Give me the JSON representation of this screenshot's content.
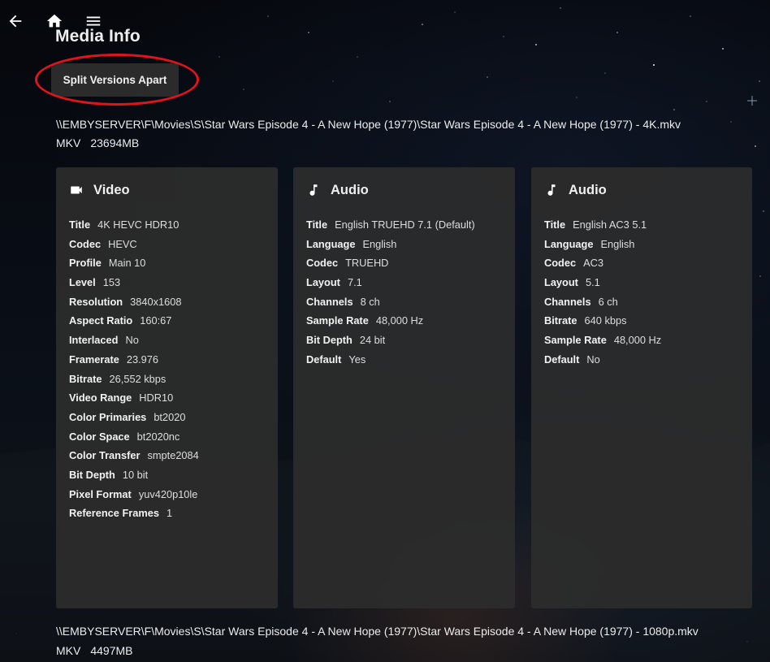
{
  "header": {
    "back_icon": "arrow-left-icon",
    "home_icon": "home-icon",
    "menu_icon": "hamburger-menu-icon"
  },
  "page": {
    "title": "Media Info",
    "split_button": "Split Versions Apart",
    "highlight_color": "#e1141c"
  },
  "versions": [
    {
      "path": "\\\\EMBYSERVER\\F\\Movies\\S\\Star Wars Episode 4 - A New Hope (1977)\\Star Wars Episode 4 - A New Hope (1977) - 4K.mkv",
      "container": "MKV",
      "size": "23694MB"
    },
    {
      "path": "\\\\EMBYSERVER\\F\\Movies\\S\\Star Wars Episode 4 - A New Hope (1977)\\Star Wars Episode 4 - A New Hope (1977) - 1080p.mkv",
      "container": "MKV",
      "size": "4497MB"
    }
  ],
  "streams": [
    {
      "type": "Video",
      "icon": "video-camera-icon",
      "rows": [
        {
          "k": "Title",
          "v": "4K HEVC HDR10"
        },
        {
          "k": "Codec",
          "v": "HEVC"
        },
        {
          "k": "Profile",
          "v": "Main 10"
        },
        {
          "k": "Level",
          "v": "153"
        },
        {
          "k": "Resolution",
          "v": "3840x1608"
        },
        {
          "k": "Aspect Ratio",
          "v": "160:67"
        },
        {
          "k": "Interlaced",
          "v": "No"
        },
        {
          "k": "Framerate",
          "v": "23.976"
        },
        {
          "k": "Bitrate",
          "v": "26,552 kbps"
        },
        {
          "k": "Video Range",
          "v": "HDR10"
        },
        {
          "k": "Color Primaries",
          "v": "bt2020"
        },
        {
          "k": "Color Space",
          "v": "bt2020nc"
        },
        {
          "k": "Color Transfer",
          "v": "smpte2084"
        },
        {
          "k": "Bit Depth",
          "v": "10 bit"
        },
        {
          "k": "Pixel Format",
          "v": "yuv420p10le"
        },
        {
          "k": "Reference Frames",
          "v": "1"
        }
      ]
    },
    {
      "type": "Audio",
      "icon": "music-note-icon",
      "rows": [
        {
          "k": "Title",
          "v": "English TRUEHD 7.1 (Default)"
        },
        {
          "k": "Language",
          "v": "English"
        },
        {
          "k": "Codec",
          "v": "TRUEHD"
        },
        {
          "k": "Layout",
          "v": "7.1"
        },
        {
          "k": "Channels",
          "v": "8 ch"
        },
        {
          "k": "Sample Rate",
          "v": "48,000 Hz"
        },
        {
          "k": "Bit Depth",
          "v": "24 bit"
        },
        {
          "k": "Default",
          "v": "Yes"
        }
      ]
    },
    {
      "type": "Audio",
      "icon": "music-note-icon",
      "rows": [
        {
          "k": "Title",
          "v": "English AC3 5.1"
        },
        {
          "k": "Language",
          "v": "English"
        },
        {
          "k": "Codec",
          "v": "AC3"
        },
        {
          "k": "Layout",
          "v": "5.1"
        },
        {
          "k": "Channels",
          "v": "6 ch"
        },
        {
          "k": "Bitrate",
          "v": "640 kbps"
        },
        {
          "k": "Sample Rate",
          "v": "48,000 Hz"
        },
        {
          "k": "Default",
          "v": "No"
        }
      ]
    }
  ]
}
